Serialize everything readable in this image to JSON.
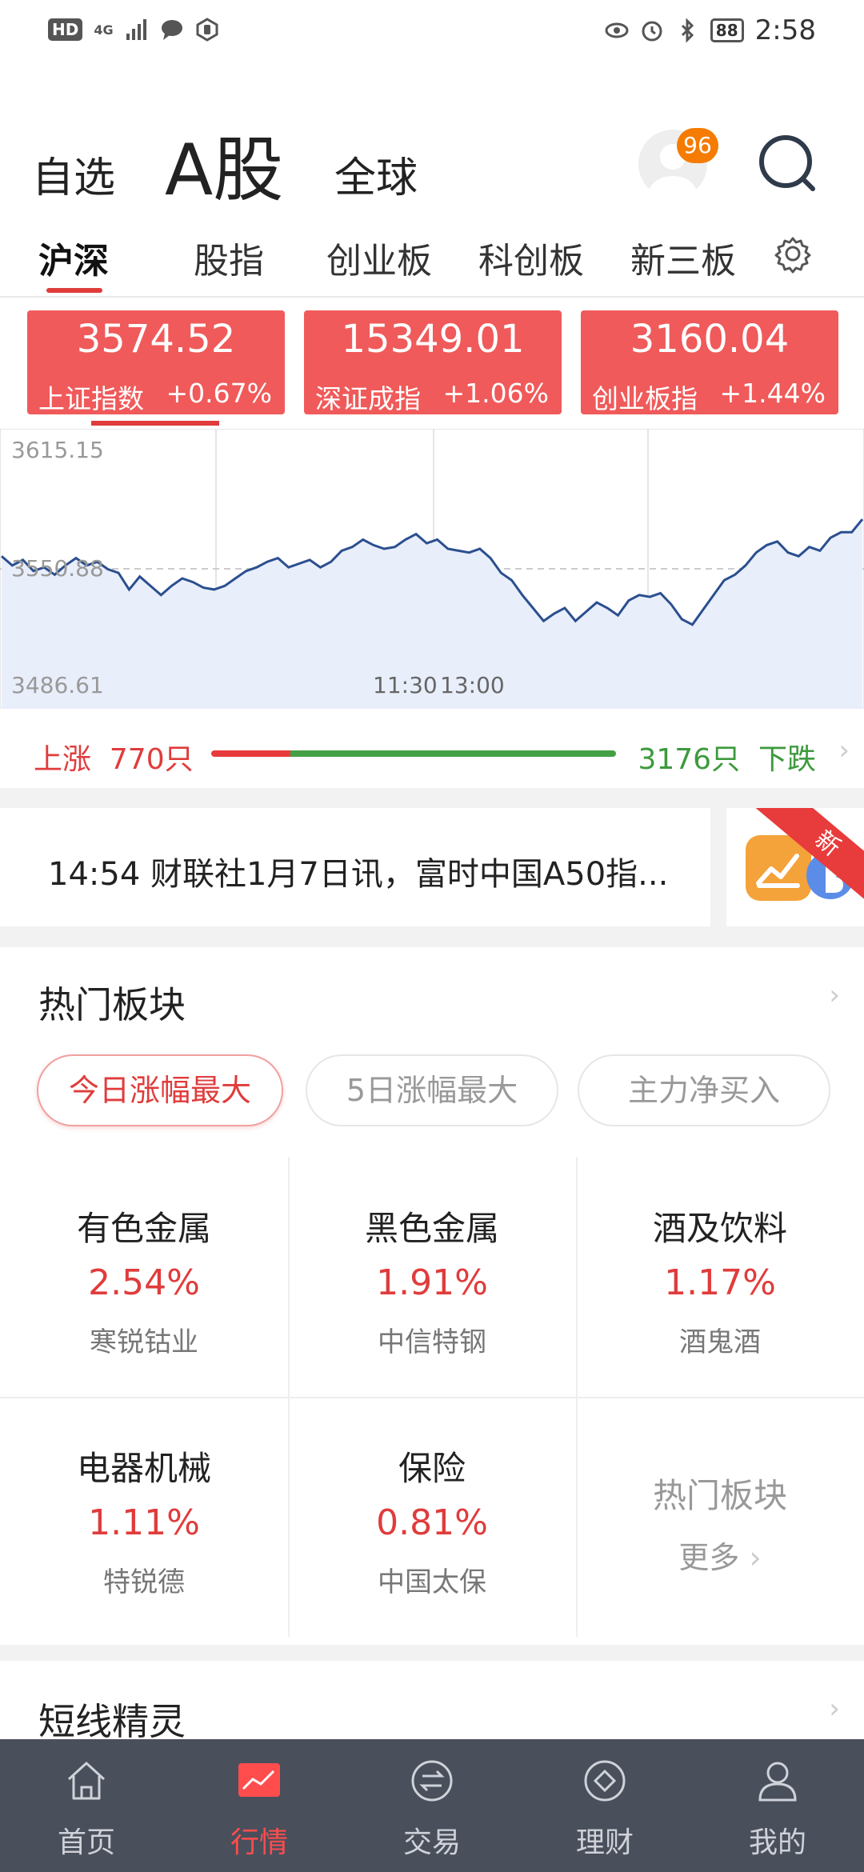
{
  "status_bar": {
    "left_badge": "HD",
    "network": "4G",
    "battery": "88",
    "time": "2:58"
  },
  "header": {
    "tabs": [
      "自选",
      "A股",
      "全球"
    ],
    "active_tab": "A股",
    "notification_count": "96"
  },
  "sub_tabs": {
    "items": [
      "沪深",
      "股指",
      "创业板",
      "科创板",
      "新三板"
    ],
    "active": "沪深"
  },
  "index_cards": [
    {
      "value": "3574.52",
      "name": "上证指数",
      "change": "+0.67%"
    },
    {
      "value": "15349.01",
      "name": "深证成指",
      "change": "+1.06%"
    },
    {
      "value": "3160.04",
      "name": "创业板指",
      "change": "+1.44%"
    }
  ],
  "chart_data": {
    "type": "area",
    "title": "",
    "xlabel": "",
    "ylabel": "",
    "y_tick_labels": [
      "3615.15",
      "3550.88",
      "3486.61"
    ],
    "ylim": [
      3486.61,
      3615.15
    ],
    "reference_value": 3550.88,
    "x_tick_labels": [
      "11:30",
      "13:00"
    ],
    "grid": true,
    "series": [
      {
        "values": [
          3554,
          3549,
          3552,
          3546,
          3548,
          3544,
          3549,
          3553,
          3549,
          3551,
          3547,
          3545,
          3536,
          3543,
          3538,
          3533,
          3538,
          3542,
          3540,
          3537,
          3536,
          3538,
          3542,
          3546,
          3548,
          3551,
          3553,
          3548,
          3550,
          3552,
          3548,
          3551,
          3557,
          3559,
          3563,
          3560,
          3558,
          3559,
          3563,
          3566,
          3561,
          3563,
          3558,
          3557,
          3556,
          3558,
          3553,
          3545,
          3541,
          3533,
          3526,
          3519,
          3523,
          3526,
          3519,
          3524,
          3529,
          3526,
          3522,
          3530,
          3533,
          3532,
          3534,
          3528,
          3520,
          3517,
          3525,
          3533,
          3541,
          3544,
          3549,
          3556,
          3560,
          3562,
          3556,
          3554,
          3559,
          3557,
          3564,
          3567,
          3567,
          3574
        ]
      }
    ]
  },
  "breadth": {
    "up_label": "上涨",
    "up_count": "770只",
    "down_count": "3176只",
    "down_label": "下跌",
    "up_fraction": 0.195
  },
  "news": {
    "text": "14:54 财联社1月7日讯，富时中国A50指..."
  },
  "promo": {
    "ribbon": "新"
  },
  "hot_sectors": {
    "title": "热门板块",
    "filters": [
      "今日涨幅最大",
      "5日涨幅最大",
      "主力净买入"
    ],
    "active_filter": "今日涨幅最大",
    "items": [
      {
        "name": "有色金属",
        "change": "2.54%",
        "leader": "寒锐钴业"
      },
      {
        "name": "黑色金属",
        "change": "1.91%",
        "leader": "中信特钢"
      },
      {
        "name": "酒及饮料",
        "change": "1.17%",
        "leader": "酒鬼酒"
      },
      {
        "name": "电器机械",
        "change": "1.11%",
        "leader": "特锐德"
      },
      {
        "name": "保险",
        "change": "0.81%",
        "leader": "中国太保"
      }
    ],
    "more_title": "热门板块",
    "more_label": "更多"
  },
  "short_line": {
    "title": "短线精灵"
  },
  "bottom_nav": {
    "items": [
      "首页",
      "行情",
      "交易",
      "理财",
      "我的"
    ],
    "active": "行情"
  },
  "colors": {
    "red": "#e03c3c",
    "green": "#3d9a3d",
    "card_red": "#f05a5a",
    "nav_bg": "#4a4f5c",
    "chart_line": "#2b4f8f",
    "chart_fill": "#e8eefa"
  }
}
